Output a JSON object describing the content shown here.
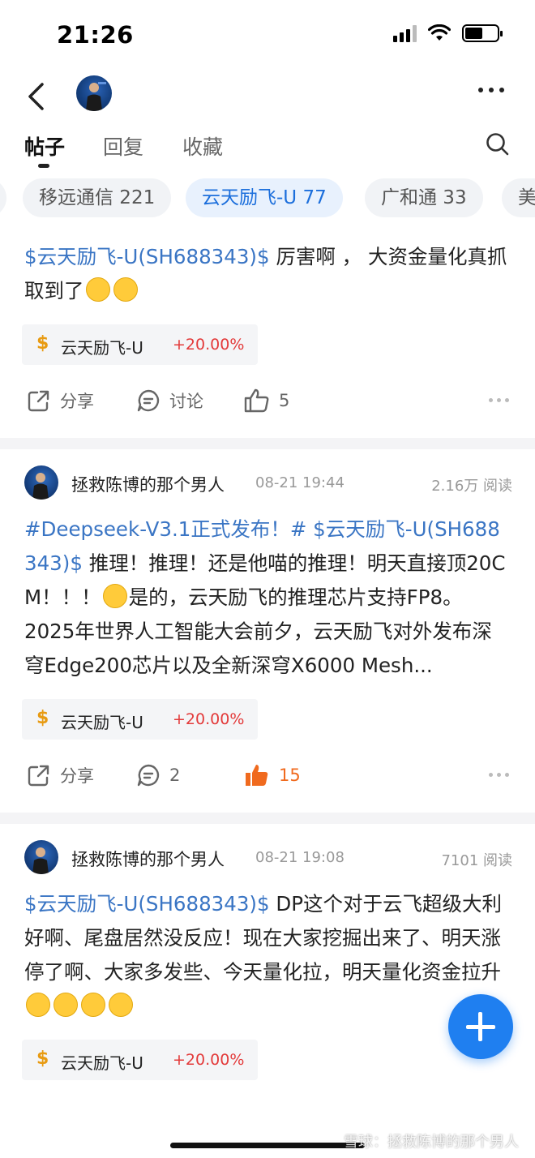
{
  "status_bar": {
    "time": "21:26"
  },
  "tabs": [
    {
      "label": "帖子",
      "active": true
    },
    {
      "label": "回复",
      "active": false
    },
    {
      "label": "收藏",
      "active": false
    }
  ],
  "chips": [
    {
      "label": "移远通信 221",
      "active": false
    },
    {
      "label": "云天励飞-U 77",
      "active": true
    },
    {
      "label": "广和通 33",
      "active": false
    },
    {
      "label": "美",
      "active": false
    }
  ],
  "posts": [
    {
      "stock_link": "$云天励飞-U(SH688343)$",
      "text": " 厉害啊 ，  大资金量化真抓取到了",
      "emojis": [
        "grinning-squint-emoji",
        "grinning-squint-emoji"
      ],
      "tag": {
        "name": "云天励飞-U",
        "change": "+20.00%"
      },
      "actions": {
        "share": "分享",
        "comment": "讨论",
        "likes": "5"
      }
    },
    {
      "author": "拯救陈博的那个男人",
      "time": "08-21 19:44",
      "reads": "2.16万 阅读",
      "topic_link": "#Deepseek-V3.1正式发布！#",
      "stock_link": "$云天励飞-U(SH688343)$",
      "text_1": " 推理！推理！还是他喵的推理！明天直接顶20CM！！！",
      "text_2": "是的，云天励飞的推理芯片支持FP8。",
      "text_3": "2025年世界人工智能大会前夕，云天励飞对外发布深穹Edge200芯片以及全新深穹X6000 Mesh...",
      "tag": {
        "name": "云天励飞-U",
        "change": "+20.00%"
      },
      "actions": {
        "share": "分享",
        "comments": "2",
        "likes": "15"
      }
    },
    {
      "author": "拯救陈博的那个男人",
      "time": "08-21 19:08",
      "reads": "7101 阅读",
      "stock_link": "$云天励飞-U(SH688343)$",
      "text": " DP这个对于云飞超级大利好啊、尾盘居然没反应！现在大家挖掘出来了、明天涨停了啊、大家多发些、今天量化拉，明天量化资金拉升",
      "tag": {
        "name": "云天励飞-U",
        "change": "+20.00%"
      }
    }
  ],
  "watermark": "雪球：拯救陈博的那个男人",
  "colors": {
    "link": "#3a75c4",
    "accent": "#1f7ff0",
    "up": "#e33a3a",
    "liked": "#f06a1e"
  }
}
